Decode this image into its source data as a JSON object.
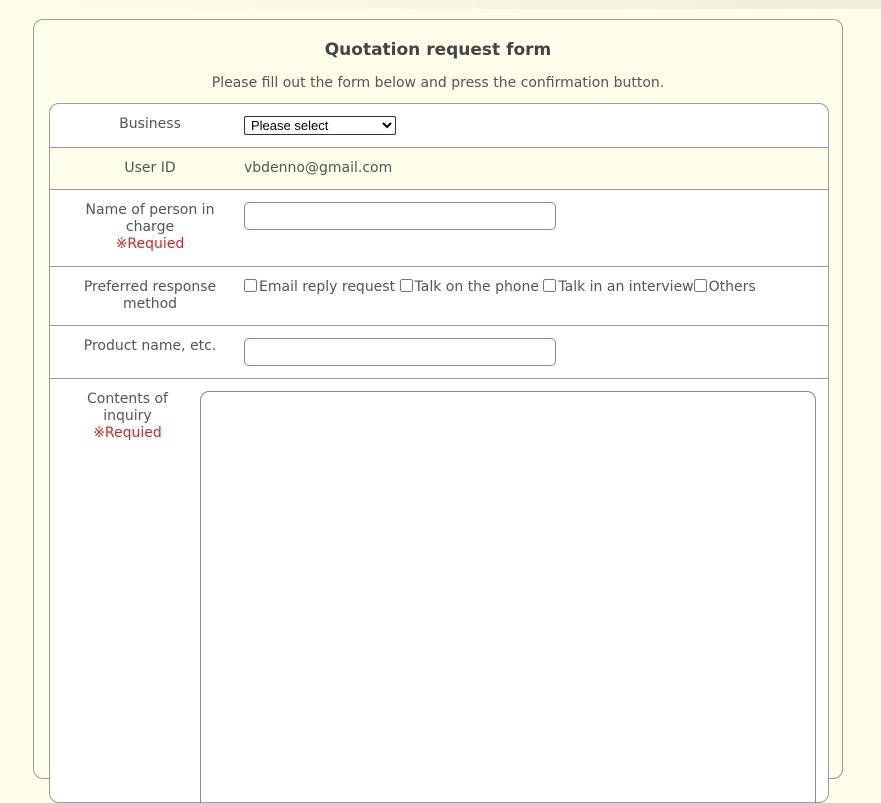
{
  "form": {
    "title": "Quotation request form",
    "subtitle": "Please fill out the form below and press the confirmation button.",
    "required_mark": "※Requied"
  },
  "rows": {
    "business": {
      "label": "Business",
      "selected": "Please select"
    },
    "user_id": {
      "label": "User ID",
      "value": "vbdenno@gmail.com"
    },
    "person": {
      "label": "Name of person in charge",
      "required": "※Requied",
      "value": ""
    },
    "response": {
      "label": "Preferred response method",
      "options": [
        "Email reply request",
        "Talk on the phone",
        "Talk in an interview",
        "Others"
      ]
    },
    "product": {
      "label": "Product name, etc.",
      "value": ""
    },
    "contents": {
      "label": "Contents of inquiry",
      "required": "※Requied",
      "value": ""
    }
  },
  "colors": {
    "page_background": "#fefee9",
    "panel_background": "#fefeea",
    "required_text": "#dd2222",
    "border": "#9a9a9a"
  }
}
